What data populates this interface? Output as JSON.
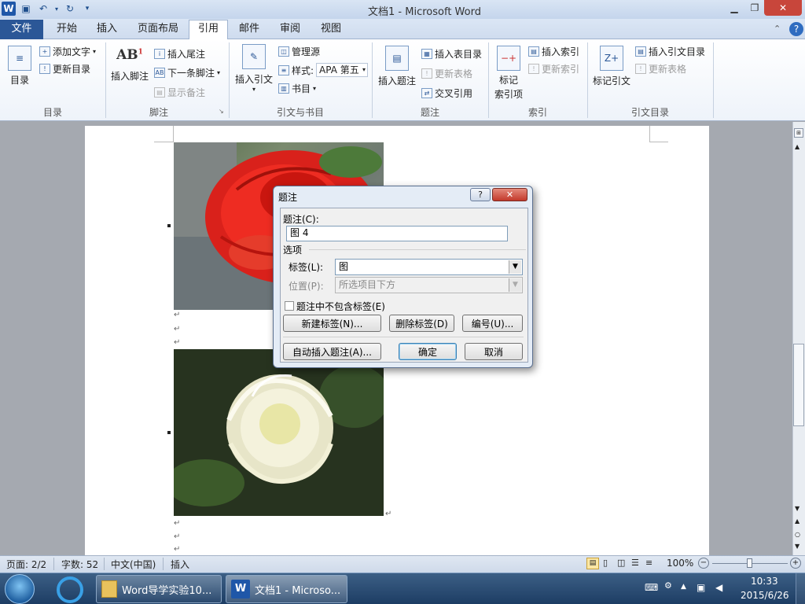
{
  "window": {
    "title": "文档1 - Microsoft Word"
  },
  "ribbon_tabs": [
    "文件",
    "开始",
    "插入",
    "页面布局",
    "引用",
    "邮件",
    "审阅",
    "视图"
  ],
  "ribbon": {
    "toc": {
      "group": "目录",
      "big": "目录",
      "add_text": "添加文字",
      "update": "更新目录"
    },
    "footnotes": {
      "group": "脚注",
      "insert_footnote": "插入脚注",
      "insert_endnote": "插入尾注",
      "next_footnote": "下一条脚注",
      "show_notes": "显示备注"
    },
    "citations": {
      "group": "引文与书目",
      "insert_citation": "插入引文",
      "manage_sources": "管理源",
      "style_label": "样式:",
      "style_value": "APA 第五",
      "bibliography": "书目"
    },
    "captions": {
      "group": "题注",
      "insert_caption": "插入题注",
      "insert_table_of_figures": "插入表目录",
      "update_table": "更新表格",
      "cross_reference": "交叉引用"
    },
    "index": {
      "group": "索引",
      "mark_entry_line1": "标记",
      "mark_entry_line2": "索引项",
      "insert_index": "插入索引",
      "update_index": "更新索引"
    },
    "toa": {
      "group": "引文目录",
      "mark_citation": "标记引文",
      "insert_toa": "插入引文目录",
      "update_table": "更新表格"
    }
  },
  "dialog": {
    "title": "题注",
    "caption_label": "题注(C):",
    "caption_value": "图 4",
    "options_label": "选项",
    "label_label": "标签(L):",
    "label_value": "图",
    "position_label": "位置(P):",
    "position_value": "所选项目下方",
    "exclude_label_checkbox": "题注中不包含标签(E)",
    "new_label_button": "新建标签(N)...",
    "delete_label_button": "删除标签(D)",
    "numbering_button": "编号(U)...",
    "autocaption_button": "自动插入题注(A)...",
    "ok_button": "确定",
    "cancel_button": "取消"
  },
  "status_bar": {
    "page": "页面: 2/2",
    "words": "字数: 52",
    "language": "中文(中国)",
    "mode": "插入",
    "zoom": "100%"
  },
  "taskbar": {
    "buttons": [
      "Word导学实验10...",
      "文档1 - Microso..."
    ],
    "time": "10:33",
    "date": "2015/6/26"
  },
  "colors": {
    "accent": "#2b5797",
    "ribbon_bg": "#eef3fa",
    "taskbar": "#1d3d64"
  },
  "icons": [
    "word-logo-icon",
    "save-icon",
    "undo-icon",
    "redo-icon",
    "help-icon",
    "start-orb-icon",
    "folder-icon"
  ]
}
